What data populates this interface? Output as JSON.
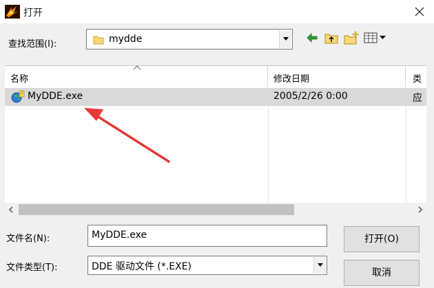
{
  "window": {
    "title": "打开",
    "close_glyph": "✕"
  },
  "lookin": {
    "label": "查找范围(I):",
    "value": "mydde"
  },
  "toolbar": {
    "icons": [
      "back-arrow-icon",
      "up-folder-icon",
      "new-folder-icon",
      "view-menu-icon"
    ]
  },
  "filelist": {
    "columns": [
      "名称",
      "修改日期",
      "类"
    ],
    "rows": [
      {
        "name": "MyDDE.exe",
        "modified": "2005/2/26 0:00",
        "type": "应"
      }
    ]
  },
  "filename": {
    "label": "文件名(N):",
    "value": "MyDDE.exe"
  },
  "filetype": {
    "label": "文件类型(T):",
    "value": "DDE 驱动文件 (*.EXE)"
  },
  "buttons": {
    "open": "打开(O)",
    "cancel": "取消"
  },
  "colors": {
    "row_highlight": "#d9d9d9",
    "annotation_arrow": "#e53935",
    "window_bg": "#f0f0f0"
  }
}
